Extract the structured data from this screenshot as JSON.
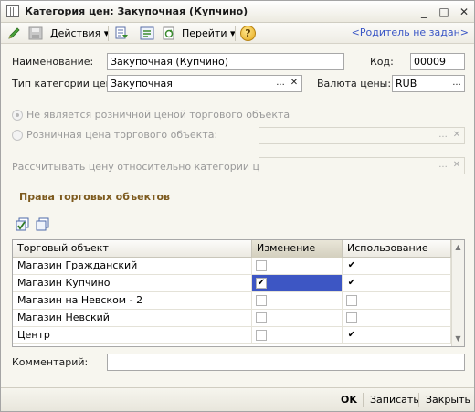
{
  "window": {
    "title": "Категория цен: Закупочная (Купчино)",
    "controls": [
      "_",
      "□",
      "✕"
    ]
  },
  "toolbar": {
    "actions_label": "Действия",
    "goto_label": "Перейти",
    "help_label": "?",
    "parent_link": "<Родитель не задан>"
  },
  "form": {
    "name_label": "Наименование:",
    "name_value": "Закупочная (Купчино)",
    "code_label": "Код:",
    "code_value": "00009",
    "type_label": "Тип категории цен:",
    "type_value": "Закупочная",
    "currency_label": "Валюта цены:",
    "currency_value": "RUB",
    "radio_not_retail": "Не является розничной ценой торгового объекта",
    "radio_retail": "Розничная цена торгового объекта:",
    "relative_label": "Рассчитывать цену относительно категории цен:",
    "comment_label": "Комментарий:",
    "comment_value": ""
  },
  "rights": {
    "section_title": "Права торговых объектов",
    "columns": [
      "Торговый объект",
      "Изменение",
      "Использование"
    ],
    "rows": [
      {
        "name": "Магазин Гражданский",
        "change": false,
        "use": true
      },
      {
        "name": "Магазин Купчино",
        "change": true,
        "use": true
      },
      {
        "name": "Магазин на Невском - 2",
        "change": false,
        "use": false
      },
      {
        "name": "Магазин Невский",
        "change": false,
        "use": false
      },
      {
        "name": "Центр",
        "change": false,
        "use": true
      }
    ]
  },
  "status": {
    "ok": "OK",
    "save": "Записать",
    "close": "Закрыть"
  },
  "glyphs": {
    "ellipsis": "...",
    "clear": "✕",
    "dropdown": "▾",
    "check": "✔",
    "scroll_up": "▲",
    "scroll_down": "▼"
  }
}
